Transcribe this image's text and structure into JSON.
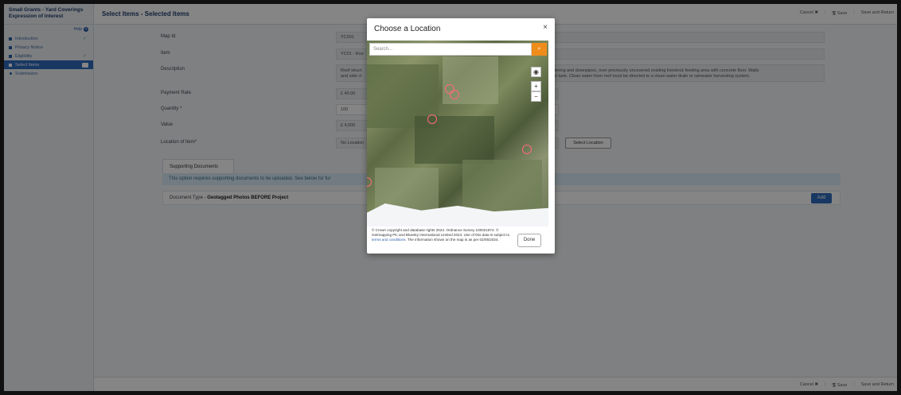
{
  "app": {
    "brand_line1": "Small Grants - Yard Coverings",
    "brand_line2": "Expression of Interest",
    "help": "Help"
  },
  "sidebar": {
    "items": [
      {
        "label": "Introduction"
      },
      {
        "label": "Privacy Notice"
      },
      {
        "label": "Eligibility"
      },
      {
        "label": "Select Items"
      },
      {
        "label": "Submission"
      }
    ]
  },
  "header": {
    "title": "Select Items - Selected Items",
    "cancel": "Cancel",
    "save": "Save",
    "save_return": "Save and Return"
  },
  "form": {
    "map_id_label": "Map Id",
    "map_id_value": "YC001",
    "item_label": "Item",
    "item_value": "YC01 - Roo",
    "description_label": "Description",
    "description_value_left_1": "Roof struct",
    "description_value_left_2": "and side cl",
    "description_value_right_1": "of guttering and downpipes, over previously uncovered existing livestock feeding area with concrete floor. Walls",
    "description_value_right_2": "llection tank. Clean water from roof must be directed to a clean water drain or rainwater harvesting system.",
    "payment_rate_label": "Payment Rate",
    "payment_rate_value": "£  40.00",
    "quantity_label": "Quantity *",
    "quantity_value": "100",
    "value_label": "Value",
    "value_value": "£  4,000",
    "location_label": "Location of Item*",
    "location_value": "No Location",
    "select_location": "Select Location"
  },
  "documents": {
    "tab": "Supporting Documents",
    "info": "This option requires supporting documents to be uploaded. See below for fur",
    "doc_type_label": "Document Type - ",
    "doc_type_value": "Geotagged Photos BEFORE Project",
    "add": "Add"
  },
  "modal": {
    "title": "Choose a Location",
    "close": "×",
    "search_placeholder": "Search...",
    "attribution_1": "© Crown copyright and database rights 2024. Ordnance Survey 100021874. ©",
    "attribution_2": "Getmapping Plc and Bluesky International Limited 2024. Use of this data is subject to",
    "attribution_link": "terms and conditions",
    "attribution_3": ". The information shown on the map is as per 02/05/2024.",
    "done": "Done"
  },
  "icons": {
    "search": "search-icon",
    "locate": "target-icon",
    "zoom_in": "+",
    "zoom_out": "−"
  },
  "colors": {
    "primary": "#2e6bbf",
    "accent_orange": "#f08c1a",
    "marker": "#ff6b7a",
    "info_bg": "#d8ecf7"
  }
}
